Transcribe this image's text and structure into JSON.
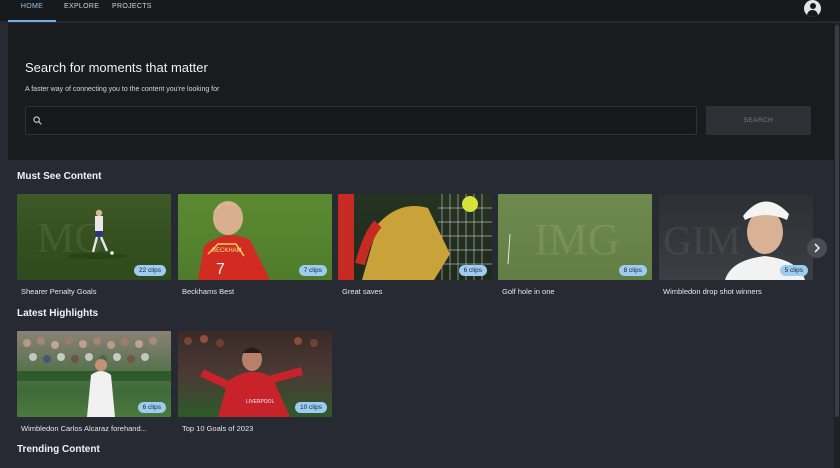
{
  "nav": {
    "tabs": [
      {
        "label": "HOME",
        "active": true
      },
      {
        "label": "EXPLORE",
        "active": false
      },
      {
        "label": "PROJECTS",
        "active": false
      }
    ],
    "account_icon": "account-circle-icon"
  },
  "hero": {
    "title": "Search for moments that matter",
    "subtitle": "A faster way of connecting you to the content you're looking for",
    "search_placeholder": "",
    "search_value": "",
    "search_button": "SEARCH"
  },
  "sections": {
    "must_see": {
      "title": "Must See Content",
      "items": [
        {
          "label": "Shearer Penalty Goals",
          "clips": "22 clips"
        },
        {
          "label": "Beckhams Best",
          "clips": "7 clips"
        },
        {
          "label": "Great saves",
          "clips": "6 clips"
        },
        {
          "label": "Golf hole in one",
          "clips": "8 clips"
        },
        {
          "label": "Wimbledon drop shot winners",
          "clips": "5 clips"
        }
      ]
    },
    "latest": {
      "title": "Latest Highlights",
      "items": [
        {
          "label": "Wimbledon Carlos Alcaraz forehand...",
          "clips": "6 clips"
        },
        {
          "label": "Top 10 Goals of 2023",
          "clips": "10 clips"
        }
      ]
    },
    "trending": {
      "title": "Trending Content"
    }
  },
  "colors": {
    "accent": "#6fb0e8",
    "badge": "#9ecbf0",
    "background": "#272a33",
    "hero_background": "#1a1b1f",
    "nav_background": "#18191d"
  }
}
